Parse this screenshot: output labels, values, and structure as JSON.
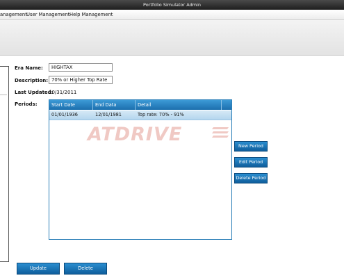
{
  "window": {
    "title": "Portfolio Simulator Admin"
  },
  "menu": {
    "items": [
      "anagement",
      "User Management",
      "Help Management"
    ]
  },
  "form": {
    "era_name": {
      "label": "Era Name:",
      "value": "HIGHTAX"
    },
    "description": {
      "label": "Description:",
      "value": "70% or Higher Top Rate"
    },
    "last_updated": {
      "label": "Last Updated:",
      "value": "10/31/2011"
    },
    "periods": {
      "label": "Periods:"
    }
  },
  "periods_table": {
    "columns": [
      "Start Date",
      "End Data",
      "Detail"
    ],
    "rows": [
      {
        "start": "01/01/1936",
        "end": "12/01/1981",
        "detail": "Top rate: 70% - 91%"
      }
    ]
  },
  "side_buttons": {
    "new": "New Period",
    "edit": "Edit Period",
    "delete": "Delete Period"
  },
  "bottom_buttons": {
    "update": "Update",
    "delete": "Delete"
  },
  "watermark": {
    "text": "ATDRIVE"
  },
  "colors": {
    "accent": "#1c6fae",
    "selected_row": "#c5e0f3",
    "titlebar": "#2a2a2a"
  }
}
